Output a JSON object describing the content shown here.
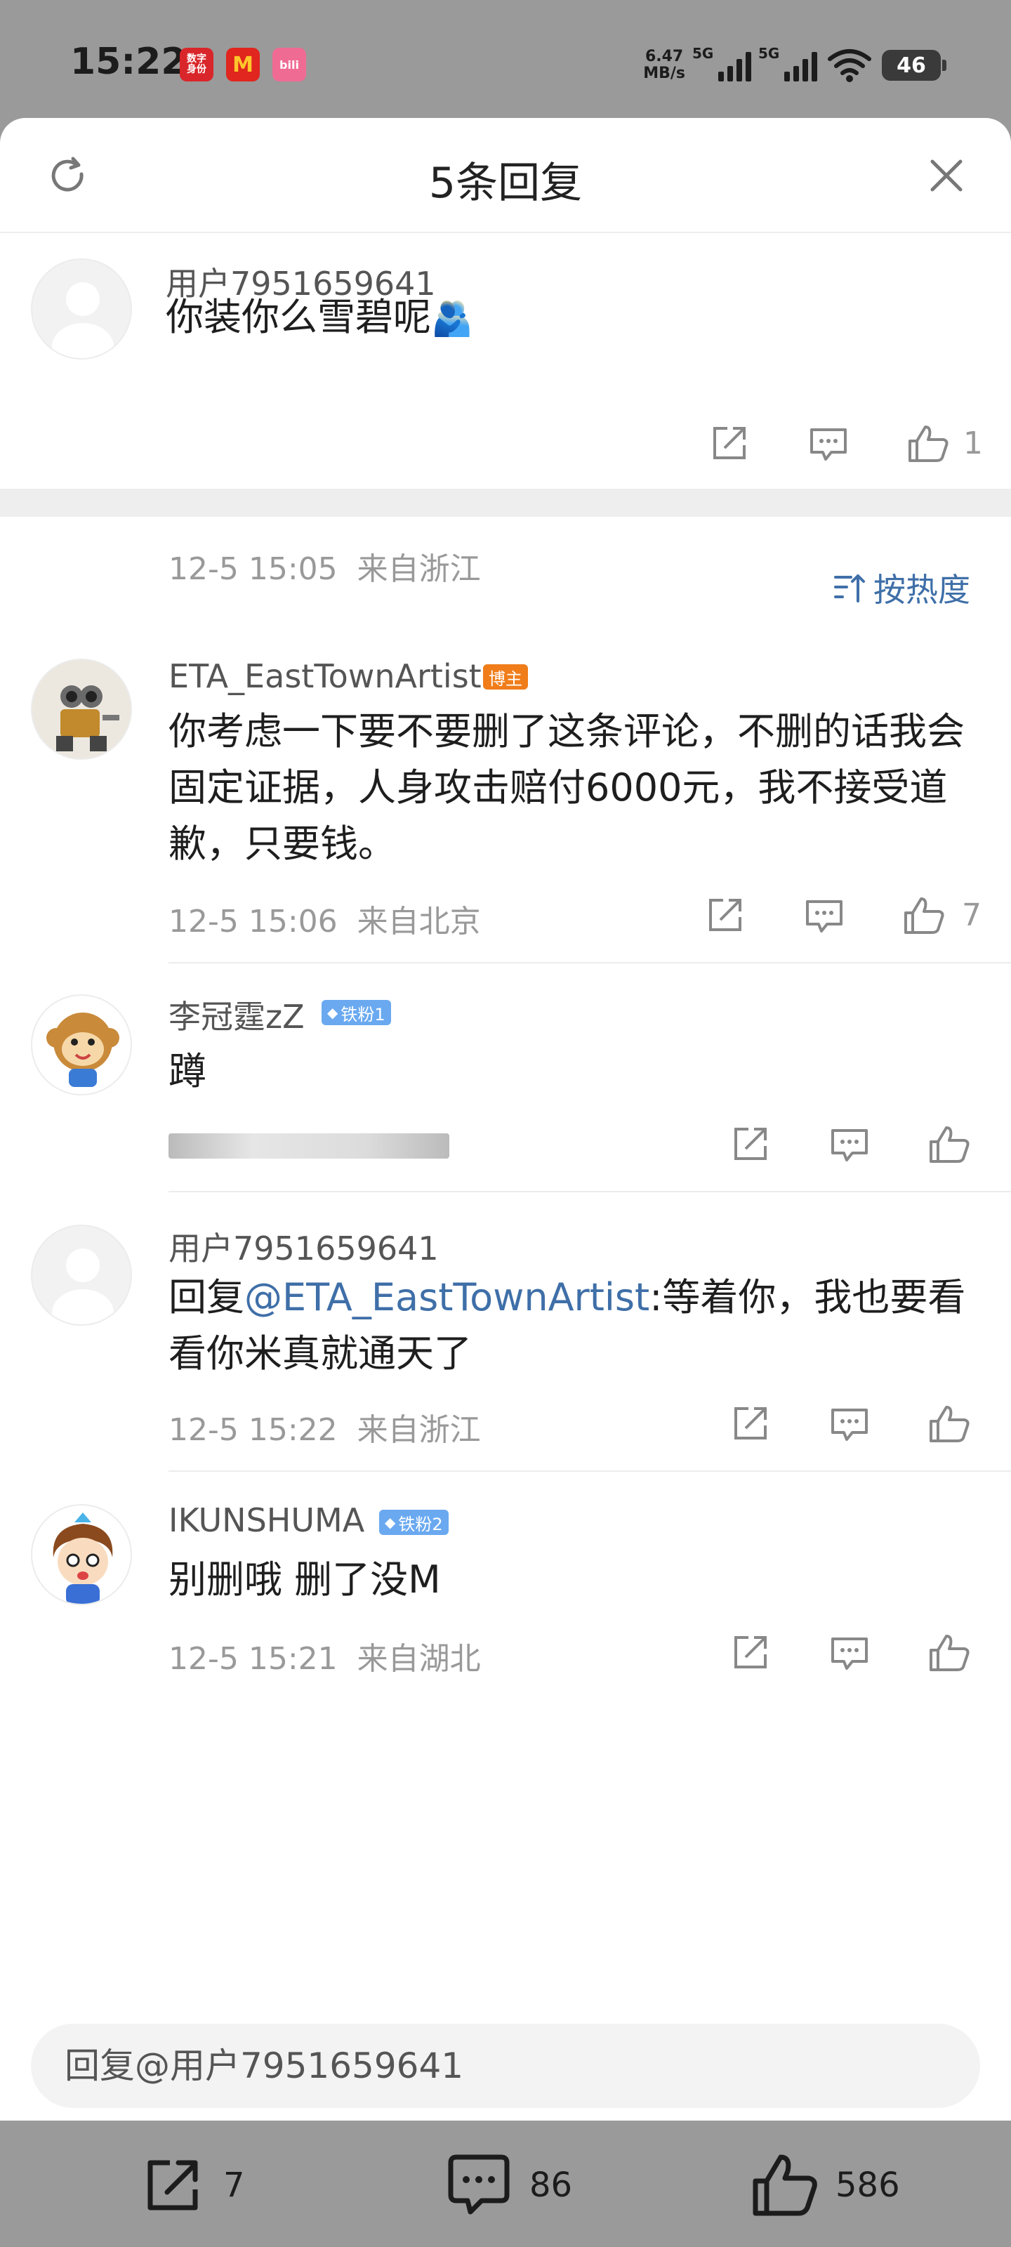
{
  "status_bar": {
    "time": "15:22",
    "apps": [
      {
        "icon": "digital-id-app-icon",
        "label": "数字\n身份",
        "color": "#d9262a"
      },
      {
        "icon": "mcdonalds-app-icon",
        "label": "M",
        "color": "#e0261e"
      },
      {
        "icon": "bilibili-app-icon",
        "label": "bili",
        "color": "#f06b93"
      }
    ],
    "net_speed_value": "6.47",
    "net_speed_unit": "MB/s",
    "sim1": "5G",
    "sim2": "5G",
    "battery": "46"
  },
  "header": {
    "title": "5条回复",
    "refresh_icon": "refresh-icon",
    "close_icon": "close-icon"
  },
  "root_comment": {
    "user": "用户7951659641",
    "text": "你装你么雪碧呢",
    "emoji": "🫂",
    "time": "12-5 15:05",
    "location": "来自浙江",
    "likes": "1"
  },
  "sort_label": "按热度",
  "replies": [
    {
      "user": "ETA_EastTownArtist",
      "badge": "博主",
      "badge_color": "#f07d1a",
      "text": "你考虑一下要不要删了这条评论，不删的话我会固定证据，人身攻击赔付6000元，我不接受道歉，只要钱。",
      "time": "12-5 15:06",
      "location": "来自北京",
      "likes": "7"
    },
    {
      "user": "李冠霆zZ",
      "badge": "铁粉1",
      "badge_color": "#6aa9f0",
      "text": "蹲",
      "time": "",
      "location": "",
      "likes": ""
    },
    {
      "user": "用户7951659641",
      "badge": "",
      "text_prefix": "回复",
      "mention": "@ETA_EastTownArtist",
      "text": ":等着你，我也要看看你米真就通天了",
      "time": "12-5 15:22",
      "location": "来自浙江",
      "likes": ""
    },
    {
      "user": "IKUNSHUMA",
      "badge": "铁粉2",
      "badge_color": "#6aa9f0",
      "text": "别删哦 删了没M",
      "time": "12-5 15:21",
      "location": "来自湖北",
      "likes": ""
    }
  ],
  "reply_input": {
    "placeholder": "回复@用户7951659641"
  },
  "bottom_bar": {
    "shares": "7",
    "comments": "86",
    "likes": "586"
  }
}
